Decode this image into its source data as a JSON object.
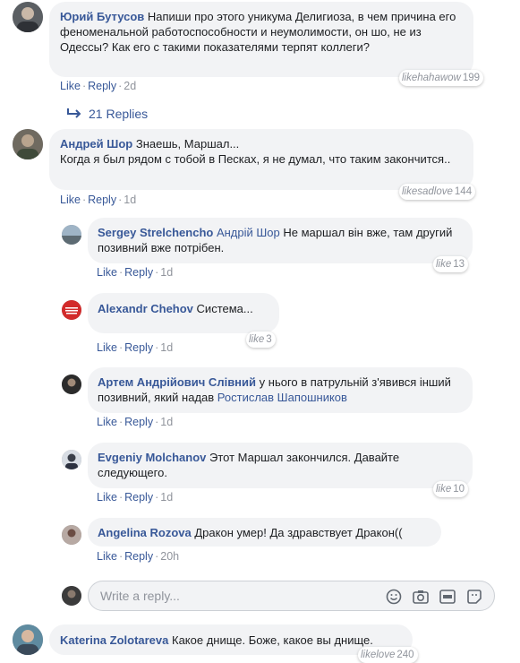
{
  "comments": [
    {
      "author": "Юрий Бутусов",
      "text": "Напиши про этого уникума Делигиоза, в чем причина его феноменальной работоспособности и неумолимости, он шо, не из Одессы? Как его с такими показателями терпят коллеги?",
      "like": "Like",
      "reply": "Reply",
      "time": "2d",
      "reactions": "likehahawow",
      "reaction_count": "199",
      "replies_label": "21 Replies"
    },
    {
      "author": "Андрей Шор",
      "text": "Знаешь, Маршал...\nКогда я был рядом с тобой в Песках, я не думал, что таким закончится..",
      "like": "Like",
      "reply": "Reply",
      "time": "1d",
      "reactions": "likesadlove",
      "reaction_count": "144"
    }
  ],
  "replies": [
    {
      "author": "Sergey Strelchencho",
      "mention": "Андрій Шор",
      "text": "Не маршал він вже, там другий позивний вже потрібен.",
      "like": "Like",
      "reply": "Reply",
      "time": "1d",
      "reactions": "like",
      "reaction_count": "13"
    },
    {
      "author": "Alexandr Chehov",
      "text": "Система...",
      "like": "Like",
      "reply": "Reply",
      "time": "1d",
      "reactions": "like",
      "reaction_count": "3"
    },
    {
      "author": "Артем Андрійович Слівний",
      "text": "у нього в патрульній з'явився інший позивний, який надав",
      "mention": "Ростислав Шапошников",
      "like": "Like",
      "reply": "Reply",
      "time": "1d"
    },
    {
      "author": "Evgeniy Molchanov",
      "text": "Этот Маршал закончился. Давайте следующего.",
      "like": "Like",
      "reply": "Reply",
      "time": "1d",
      "reactions": "like",
      "reaction_count": "10"
    },
    {
      "author": "Angelina Rozova",
      "text": "Дракон умер! Да здравствует Дракон((",
      "like": "Like",
      "reply": "Reply",
      "time": "20h"
    }
  ],
  "reply_box": {
    "placeholder": "Write a reply..."
  },
  "last_comment": {
    "author": "Katerina Zolotareva",
    "text": "Какое днище. Боже, какое вы днище.",
    "reactions": "likelove",
    "reaction_count": "240"
  },
  "colors": {
    "link": "#385898",
    "bubble": "#f2f3f5",
    "muted": "#90949c"
  }
}
